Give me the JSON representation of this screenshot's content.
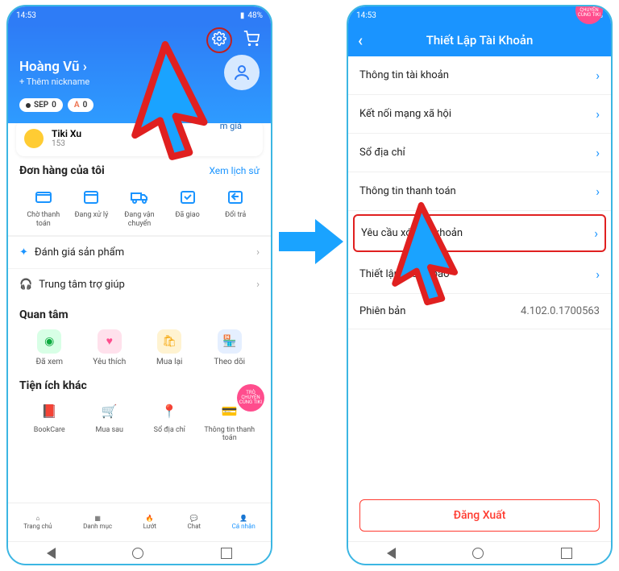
{
  "status": {
    "time": "14:53",
    "battery": "48%"
  },
  "left": {
    "user_name": "Hoàng Vũ",
    "add_nickname": "+ Thêm nickname",
    "chip_sep_label": "SEP",
    "chip_sep_value": "0",
    "chip_a_label": "A",
    "chip_a_value": "0",
    "tiki_xu": {
      "label": "Tiki Xu",
      "value": "153"
    },
    "discount_hint": "m giá",
    "orders": {
      "title": "Đơn hàng của tôi",
      "history_link": "Xem lịch sử",
      "items": [
        {
          "label": "Chờ thanh toán"
        },
        {
          "label": "Đang xử lý"
        },
        {
          "label": "Đang vận chuyển"
        },
        {
          "label": "Đã giao"
        },
        {
          "label": "Đổi trả"
        }
      ]
    },
    "review_row": "Đánh giá sản phẩm",
    "help_row": "Trung tâm trợ giúp",
    "care": {
      "title": "Quan tâm",
      "items": [
        {
          "label": "Đã xem"
        },
        {
          "label": "Yêu thích"
        },
        {
          "label": "Mua lại"
        },
        {
          "label": "Theo dõi"
        }
      ]
    },
    "utils": {
      "title": "Tiện ích khác",
      "items": [
        {
          "label": "BookCare"
        },
        {
          "label": "Mua sau"
        },
        {
          "label": "Sổ địa chỉ"
        },
        {
          "label": "Thông tin thanh toán"
        }
      ],
      "chat_badge": "TRÒ CHUYỆN CÙNG TIKI"
    },
    "bottom_nav": [
      {
        "label": "Trang chủ"
      },
      {
        "label": "Danh mục"
      },
      {
        "label": "Lướt"
      },
      {
        "label": "Chat"
      },
      {
        "label": "Cá nhân"
      }
    ]
  },
  "right": {
    "title": "Thiết Lập Tài Khoản",
    "items": [
      {
        "label": "Thông tin tài khoản"
      },
      {
        "label": "Kết nối mạng xã hội"
      },
      {
        "label": "Sổ địa chỉ"
      },
      {
        "label": "Thông tin thanh toán"
      },
      {
        "label": "Yêu cầu xóa tài khoản"
      },
      {
        "label": "Thiết lập thông báo"
      }
    ],
    "version_label": "Phiên bản",
    "version_value": "4.102.0.1700563",
    "logout": "Đăng Xuất",
    "chat_badge": "TRÒ CHUYỆN CÙNG TIKI"
  },
  "annotation": {
    "arrow_color": "#1aa3ff",
    "cursor_outline": "#e02020",
    "cursor_fill": "#1aa3ff"
  }
}
